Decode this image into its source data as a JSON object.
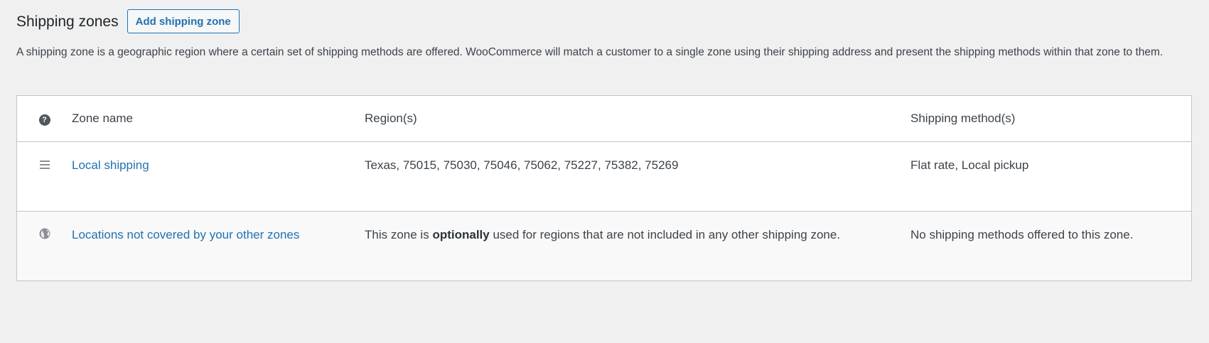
{
  "header": {
    "title": "Shipping zones",
    "add_button": "Add shipping zone"
  },
  "description": "A shipping zone is a geographic region where a certain set of shipping methods are offered. WooCommerce will match a customer to a single zone using their shipping address and present the shipping methods within that zone to them.",
  "table": {
    "columns": {
      "help_icon": "?",
      "zone_name": "Zone name",
      "regions": "Region(s)",
      "methods": "Shipping method(s)"
    },
    "rows": [
      {
        "icon": "drag-handle-icon",
        "name": "Local shipping",
        "regions": "Texas, 75015, 75030, 75046, 75062, 75227, 75382, 75269",
        "methods": "Flat rate, Local pickup"
      }
    ],
    "rest_of_world": {
      "icon": "globe-icon",
      "name": "Locations not covered by your other zones",
      "regions_prefix": "This zone is ",
      "regions_bold": "optionally",
      "regions_suffix": " used for regions that are not included in any other shipping zone.",
      "methods": "No shipping methods offered to this zone."
    }
  }
}
